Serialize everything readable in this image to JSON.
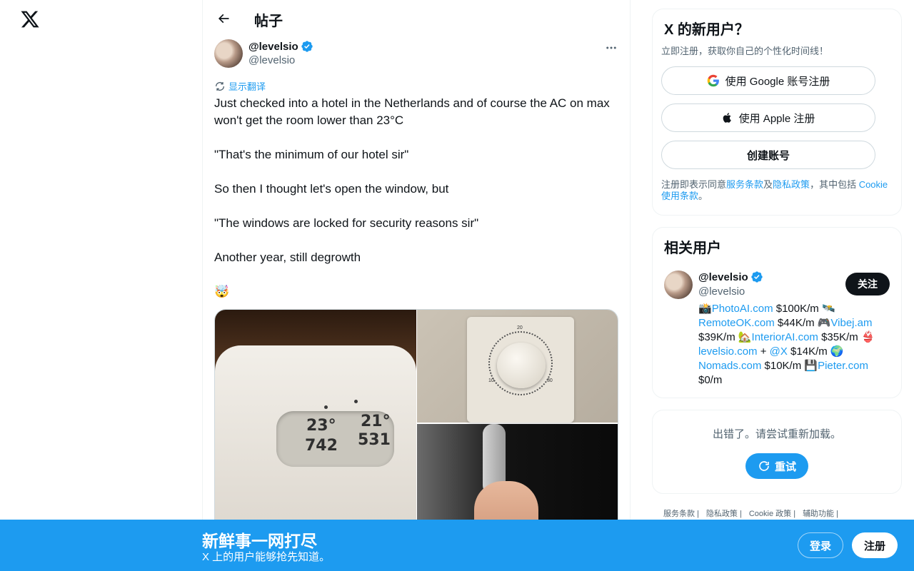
{
  "nav": {
    "logo_icon": "x-logo-icon"
  },
  "header": {
    "title": "帖子"
  },
  "tweet": {
    "display_name": "@levelsio",
    "handle": "@levelsio",
    "translate_label": "显示翻译",
    "text": "Just checked into a hotel in the Netherlands and of course the AC on max won't get the room lower than 23°C\n\n\"That's the minimum of our hotel sir\"\n\nSo then I thought let's open the window, but\n\n\"The windows are locked for security reasons sir\"\n\nAnother year, still degrowth\n\n🤯",
    "media": {
      "sensor_temp": "23°",
      "sensor_temp_out": "21°",
      "sensor_co2": "742",
      "sensor_val2": "531",
      "thermostat_top": "20",
      "thermostat_left": "10",
      "thermostat_right": "30"
    }
  },
  "signup": {
    "title": "X 的新用户？",
    "subtitle": "立即注册，获取你自己的个性化时间线！",
    "google_label": "使用 Google 账号注册",
    "apple_label": "使用 Apple 注册",
    "create_label": "创建账号",
    "legal_prefix": "注册即表示同意",
    "terms_link": "服务条款",
    "and_text": "及",
    "privacy_link": "隐私政策",
    "including_text": "，其中包括 ",
    "cookie_link": "Cookie 使用条款",
    "legal_suffix": "。"
  },
  "related": {
    "title": "相关用户",
    "name": "@levelsio",
    "handle": "@levelsio",
    "follow_label": "关注",
    "bio": [
      {
        "t": "📸"
      },
      {
        "link": "PhotoAI.com"
      },
      {
        "t": " $100K/m 🛰️ "
      },
      {
        "link": "RemoteOK.com"
      },
      {
        "t": " $44K/m 🎮"
      },
      {
        "link": "Vibej.am"
      },
      {
        "t": " $39K/m 🏡"
      },
      {
        "link": "InteriorAI.com"
      },
      {
        "t": " $35K/m 👙 "
      },
      {
        "link": "levelsio.com"
      },
      {
        "t": " + "
      },
      {
        "link": "@X"
      },
      {
        "t": " $14K/m 🌍 "
      },
      {
        "link": "Nomads.com"
      },
      {
        "t": " $10K/m 💾"
      },
      {
        "link": "Pieter.com"
      },
      {
        "t": " $0/m"
      }
    ]
  },
  "error": {
    "message": "出错了。请尝试重新加载。",
    "retry_label": "重试"
  },
  "footer": {
    "links": [
      "服务条款",
      "隐私政策",
      "Cookie 政策",
      "辅助功能"
    ]
  },
  "bottom_bar": {
    "title": "新鲜事一网打尽",
    "subtitle": "X 上的用户能够抢先知道。",
    "login_label": "登录",
    "register_label": "注册"
  },
  "colors": {
    "accent": "#1d9bf0",
    "text": "#0f1419",
    "secondary": "#536471",
    "verified": "#1d9bf0"
  }
}
